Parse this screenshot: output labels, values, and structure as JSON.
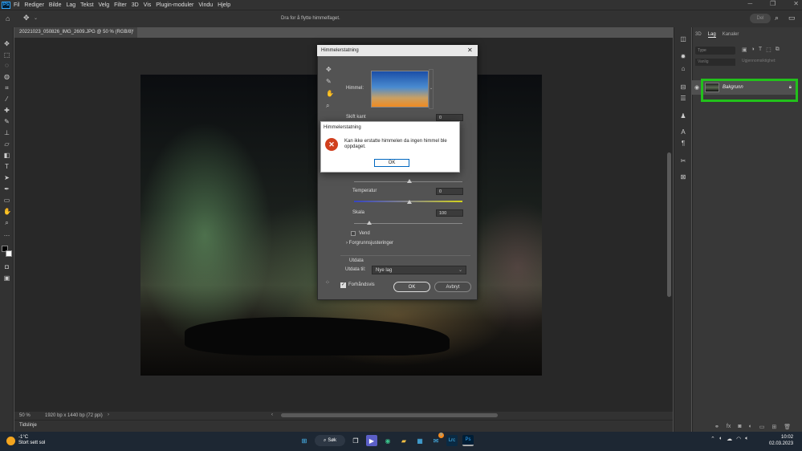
{
  "menubar": {
    "app": "Ps",
    "items": [
      "Fil",
      "Rediger",
      "Bilde",
      "Lag",
      "Tekst",
      "Velg",
      "Filter",
      "3D",
      "Vis",
      "Plugin-moduler",
      "Vindu",
      "Hjelp"
    ]
  },
  "options": {
    "hint": "Dra for å flytte himmelfaget.",
    "share": "Del"
  },
  "document": {
    "tab": "20221023_050826_IMG_2609.JPG @ 50 % (RGB/8)",
    "zoom": "50 %",
    "size": "1920 bp x 1440 bp (72 ppi)",
    "timeline": "Tidslinje"
  },
  "layers_panel": {
    "tabs": [
      "3D",
      "Lag",
      "Kanaler"
    ],
    "active_tab": "Lag",
    "filter_placeholder": "Type",
    "blend": "Vanlig",
    "opacity_label": "Ugjennomsiktighet:",
    "layer_name": "Bakgrunn"
  },
  "sky_dialog": {
    "title": "Himmelerstatning",
    "sky_label": "Himmel:",
    "shift_edge_label": "Skift kant",
    "shift_edge_value": "0",
    "temperature_label": "Temperatur",
    "temperature_value": "0",
    "scale_label": "Skala",
    "scale_value": "100",
    "flip_label": "Vend",
    "foreground_label": "Forgrunnsjusteringer",
    "output_section": "Utdata",
    "output_to_label": "Utdata til:",
    "output_to_value": "Nye lag",
    "preview_label": "Forhåndsvis",
    "ok": "OK",
    "cancel": "Avbryt"
  },
  "alert": {
    "title": "Himmelerstatning",
    "message": "Kan ikke erstatte himmelen da ingen himmel ble oppdaget.",
    "ok": "OK"
  },
  "taskbar": {
    "temp": "-1°C",
    "weather": "Stort sett sol",
    "search": "Søk",
    "mail_badge": "9",
    "time": "10:02",
    "date": "02.03.2023"
  }
}
